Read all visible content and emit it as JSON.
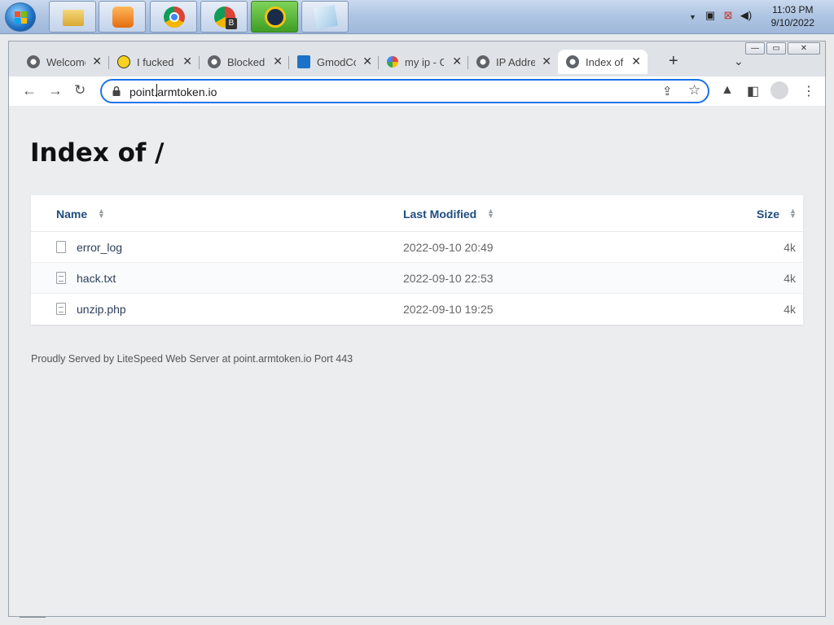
{
  "taskbar": {
    "clock_time": "11:03 PM",
    "clock_date": "9/10/2022",
    "apps": [
      {
        "name": "explorer-icon"
      },
      {
        "name": "media-player-icon"
      },
      {
        "name": "chrome-icon"
      },
      {
        "name": "chrome-profile-icon",
        "badge": "B"
      },
      {
        "name": "vpn-icon"
      },
      {
        "name": "notepad-icon"
      }
    ]
  },
  "browser": {
    "tabs": [
      {
        "label": "Welcome",
        "icon": "globe-icon"
      },
      {
        "label": "I fucked",
        "icon": "smiley-icon"
      },
      {
        "label": "Blocked",
        "icon": "globe-icon"
      },
      {
        "label": "GmodCo",
        "icon": "go-icon"
      },
      {
        "label": "my ip - G",
        "icon": "google-icon"
      },
      {
        "label": "IP Addre",
        "icon": "globe-icon"
      },
      {
        "label": "Index of",
        "icon": "globe-icon",
        "active": true
      }
    ],
    "url": "point.armtoken.io"
  },
  "page": {
    "title": "Index of /",
    "columns": {
      "name": "Name",
      "modified": "Last Modified",
      "size": "Size"
    },
    "files": [
      {
        "name": "error_log",
        "modified": "2022-09-10 20:49",
        "size": "4k",
        "icon": "file-icon"
      },
      {
        "name": "hack.txt",
        "modified": "2022-09-10 22:53",
        "size": "4k",
        "icon": "text-file-icon"
      },
      {
        "name": "unzip.php",
        "modified": "2022-09-10 19:25",
        "size": "4k",
        "icon": "text-file-icon"
      }
    ],
    "footer": "Proudly Served by LiteSpeed Web Server at point.armtoken.io Port 443"
  }
}
